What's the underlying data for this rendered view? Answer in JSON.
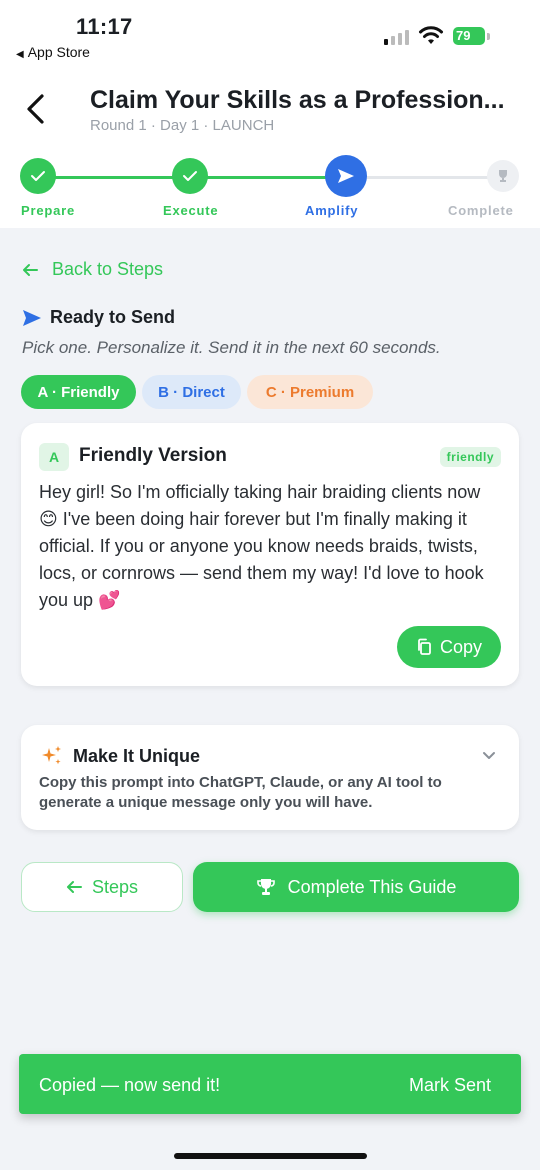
{
  "status_bar": {
    "time": "11:17",
    "back_app": "App Store",
    "battery": "79"
  },
  "header": {
    "title": "Claim Your Skills as a Profession...",
    "subtitle": "Round 1 · Day 1 · LAUNCH"
  },
  "stepper": {
    "steps": [
      {
        "label": "Prepare",
        "state": "done"
      },
      {
        "label": "Execute",
        "state": "done"
      },
      {
        "label": "Amplify",
        "state": "active"
      },
      {
        "label": "Complete",
        "state": "pending"
      }
    ]
  },
  "content": {
    "back_label": "Back to Steps",
    "ready_title": "Ready to Send",
    "ready_subtitle": "Pick one. Personalize it. Send it in the next 60 seconds.",
    "chips": [
      {
        "label": "A · Friendly",
        "selected": true
      },
      {
        "label": "B · Direct",
        "selected": false
      },
      {
        "label": "C · Premium",
        "selected": false
      }
    ]
  },
  "version_card": {
    "badge": "A",
    "title": "Friendly Version",
    "tag": "friendly",
    "message": "Hey girl! So I'm officially taking hair braiding clients now 😊  I've been doing hair forever but I'm finally making it official. If you or anyone you know needs braids, twists, locs, or cornrows — send them my way! I'd love to hook you up 💕",
    "copy_label": "Copy"
  },
  "unique_card": {
    "title": "Make It Unique",
    "description": "Copy this prompt into ChatGPT, Claude, or any AI tool to generate a unique message only you will have."
  },
  "actions": {
    "steps_label": "Steps",
    "complete_label": "Complete This Guide"
  },
  "toast": {
    "message": "Copied — now send it!",
    "action": "Mark Sent"
  },
  "colors": {
    "green": "#34c759",
    "blue": "#2f6fe4",
    "orange": "#ec7b2e",
    "background": "#f1f3f7"
  }
}
